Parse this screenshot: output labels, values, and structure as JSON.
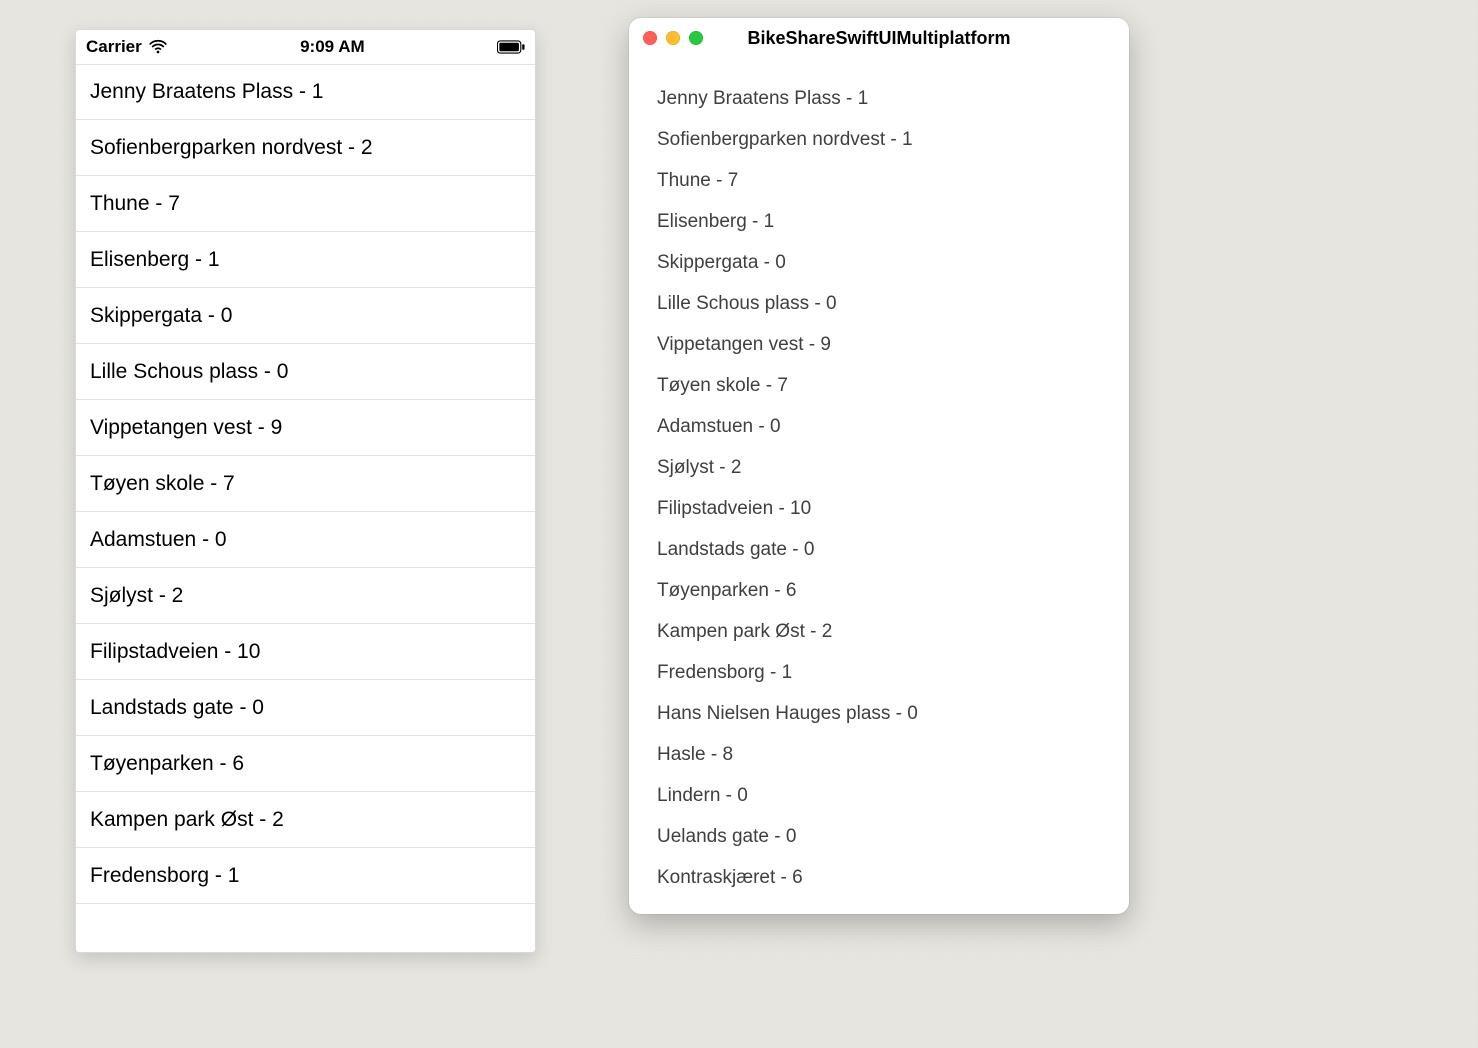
{
  "ios": {
    "statusbar": {
      "carrier": "Carrier",
      "time": "9:09 AM"
    },
    "stations": [
      {
        "name": "Jenny Braatens Plass",
        "count": 1
      },
      {
        "name": "Sofienbergparken nordvest",
        "count": 2
      },
      {
        "name": "Thune",
        "count": 7
      },
      {
        "name": "Elisenberg",
        "count": 1
      },
      {
        "name": "Skippergata",
        "count": 0
      },
      {
        "name": "Lille Schous plass",
        "count": 0
      },
      {
        "name": "Vippetangen vest",
        "count": 9
      },
      {
        "name": "Tøyen skole",
        "count": 7
      },
      {
        "name": "Adamstuen",
        "count": 0
      },
      {
        "name": "Sjølyst",
        "count": 2
      },
      {
        "name": "Filipstadveien",
        "count": 10
      },
      {
        "name": "Landstads gate",
        "count": 0
      },
      {
        "name": "Tøyenparken",
        "count": 6
      },
      {
        "name": "Kampen park Øst",
        "count": 2
      },
      {
        "name": "Fredensborg",
        "count": 1
      }
    ]
  },
  "mac": {
    "title": "BikeShareSwiftUIMultiplatform",
    "stations": [
      {
        "name": "Jenny Braatens Plass",
        "count": 1
      },
      {
        "name": "Sofienbergparken nordvest",
        "count": 1
      },
      {
        "name": "Thune",
        "count": 7
      },
      {
        "name": "Elisenberg",
        "count": 1
      },
      {
        "name": "Skippergata",
        "count": 0
      },
      {
        "name": "Lille Schous plass",
        "count": 0
      },
      {
        "name": "Vippetangen vest",
        "count": 9
      },
      {
        "name": "Tøyen skole",
        "count": 7
      },
      {
        "name": "Adamstuen",
        "count": 0
      },
      {
        "name": "Sjølyst",
        "count": 2
      },
      {
        "name": "Filipstadveien",
        "count": 10
      },
      {
        "name": "Landstads gate",
        "count": 0
      },
      {
        "name": "Tøyenparken",
        "count": 6
      },
      {
        "name": "Kampen park Øst",
        "count": 2
      },
      {
        "name": "Fredensborg",
        "count": 1
      },
      {
        "name": "Hans Nielsen Hauges plass",
        "count": 0
      },
      {
        "name": "Hasle",
        "count": 8
      },
      {
        "name": "Lindern",
        "count": 0
      },
      {
        "name": "Uelands gate",
        "count": 0
      },
      {
        "name": "Kontraskjæret",
        "count": 6
      }
    ]
  }
}
